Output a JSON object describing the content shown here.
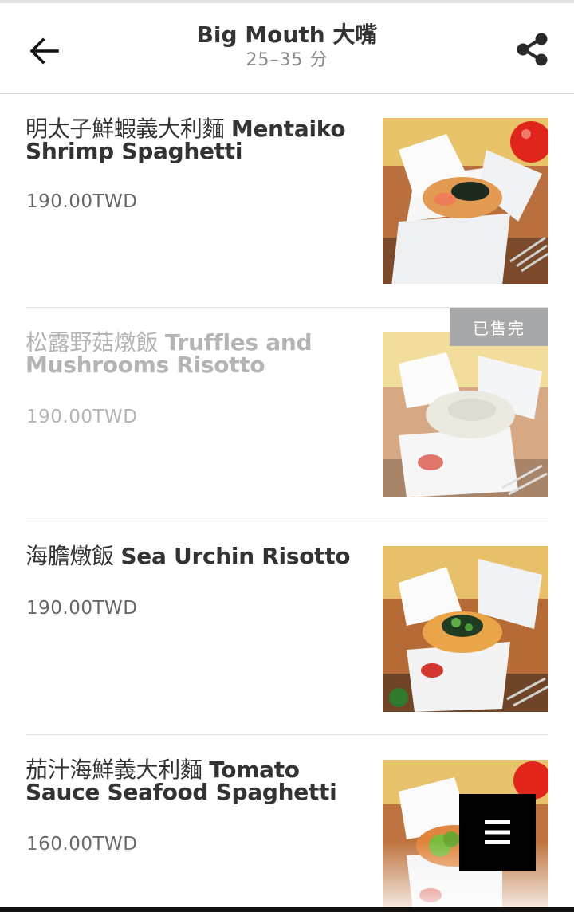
{
  "header": {
    "title": "Big Mouth 大嘴",
    "eta": "25–35 分",
    "back_icon": "arrow-left-icon",
    "share_icon": "share-icon"
  },
  "menu": {
    "items": [
      {
        "name_zh": "明太子鮮蝦義大利麵",
        "name_en": "Mentaiko Shrimp Spaghetti",
        "price": "190.00TWD",
        "sold_out": false,
        "badge": ""
      },
      {
        "name_zh": "松露野菇燉飯",
        "name_en": "Truffles and Mushrooms Risotto",
        "price": "190.00TWD",
        "sold_out": true,
        "badge": "已售完"
      },
      {
        "name_zh": "海膽燉飯",
        "name_en": "Sea Urchin Risotto",
        "price": "190.00TWD",
        "sold_out": false,
        "badge": ""
      },
      {
        "name_zh": "茄汁海鮮義大利麵",
        "name_en": "Tomato Sauce Seafood Spaghetti",
        "price": "160.00TWD",
        "sold_out": false,
        "badge": ""
      }
    ]
  },
  "fab": {
    "icon": "hamburger-menu-icon"
  },
  "colors": {
    "sold_badge": "#a7a8aa",
    "fab": "#000000",
    "text": "#333333"
  }
}
